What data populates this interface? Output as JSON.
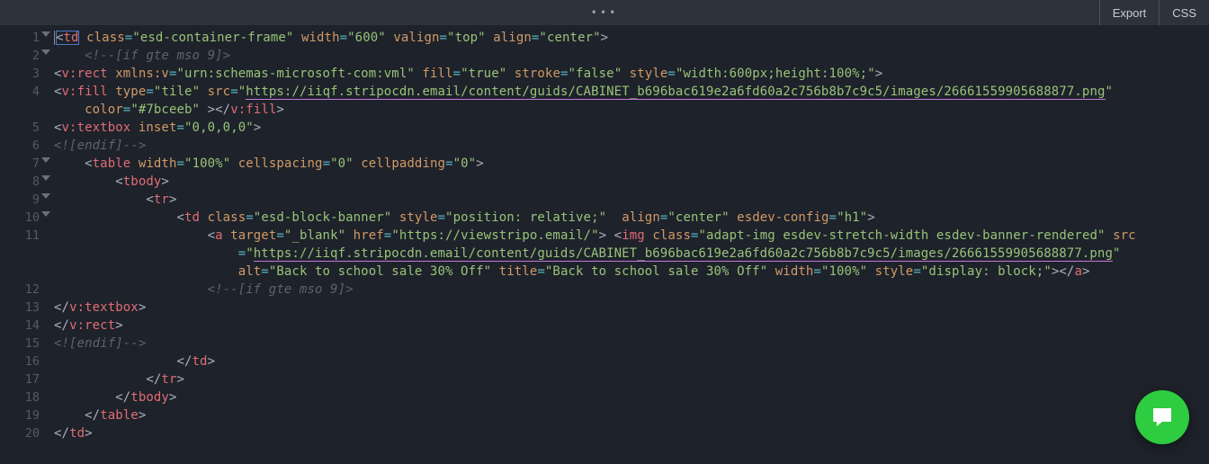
{
  "toolbar": {
    "export": "Export",
    "css": "CSS",
    "dots": "•••"
  },
  "code": {
    "url_long": "https://iiqf.stripocdn.email/content/guids/CABINET_b696bac619e2a6fd60a2c756b8b7c9c5/images/26661559905688877.png",
    "alt_text": "Back to school sale 30% Off",
    "href_view": "https://viewstripo.email/",
    "fill_color": "#7bceeb",
    "vrect_style": "width:600px;height:100%;",
    "td_class": "esd-container-frame",
    "td_width": "600",
    "td_valign": "top",
    "td_align": "center",
    "inner_td_class": "esd-block-banner",
    "inner_td_style": "position: relative;",
    "inner_td_align": "center",
    "inner_td_cfg": "h1",
    "img_class": "adapt-img esdev-stretch-width esdev-banner-rendered",
    "img_width": "100%",
    "img_style": "display: block;"
  },
  "lines": [
    1,
    2,
    3,
    4,
    5,
    6,
    7,
    8,
    9,
    10,
    11,
    12,
    13,
    14,
    15,
    16,
    17,
    18,
    19,
    20
  ],
  "fold_lines": [
    1,
    2,
    7,
    8,
    9,
    10
  ],
  "icons": {
    "chat": "chat-bubble-icon"
  }
}
